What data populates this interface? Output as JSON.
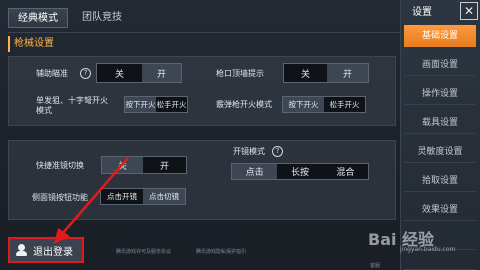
{
  "mode_tabs": [
    {
      "label": "经典模式",
      "active": true
    },
    {
      "label": "团队竞技",
      "active": false
    }
  ],
  "section_title": "枪械设置",
  "settings": {
    "aim_assist": {
      "label": "辅助瞄准",
      "help": "?",
      "off": "关",
      "on": "开",
      "selected": "开"
    },
    "peek_fire": {
      "label": "枪口顶墙提示",
      "off": "关",
      "on": "开",
      "selected": "开"
    },
    "single_fire_mode": {
      "label": "单发狙、十字弩开火模式",
      "press": "按下开火",
      "release": "松手开火",
      "selected": "按下开火"
    },
    "shotgun_fire_mode": {
      "label": "霰弹枪开火模式",
      "press": "按下开火",
      "release": "松手开火",
      "selected": "按下开火"
    },
    "quick_scope_switch": {
      "label": "快捷准镜切换",
      "off": "关",
      "on": "开",
      "selected": "关"
    },
    "side_scope_switch": {
      "label": "侧面镜按钮功能",
      "opt1": "点击开镜",
      "opt2": "点击切镜",
      "selected": "点击切镜"
    },
    "scope_mode": {
      "label": "开镜模式",
      "help": "?",
      "options": [
        "点击",
        "长按",
        "混合"
      ],
      "selected": "点击"
    }
  },
  "sidebar": {
    "title": "设置",
    "close": "✕",
    "items": [
      {
        "label": "基础设置",
        "active": true
      },
      {
        "label": "画面设置",
        "active": false
      },
      {
        "label": "操作设置",
        "active": false
      },
      {
        "label": "载具设置",
        "active": false
      },
      {
        "label": "灵敏度设置",
        "active": false
      },
      {
        "label": "拾取设置",
        "active": false
      },
      {
        "label": "效果设置",
        "active": false
      },
      {
        "label": "",
        "active": false
      },
      {
        "label": "",
        "active": false
      }
    ]
  },
  "logout": {
    "label": "退出登录"
  },
  "footer": {
    "link1": "腾讯游戏许可及服务协议",
    "link2": "腾讯游戏隐私保护指引",
    "link3": "客服"
  },
  "watermark": {
    "main": "Bai 经验",
    "sub": "jingyan.baidu.com"
  },
  "colors": {
    "accent": "#f08a2a",
    "highlight": "#e11b1b",
    "section": "#ffb34a"
  }
}
